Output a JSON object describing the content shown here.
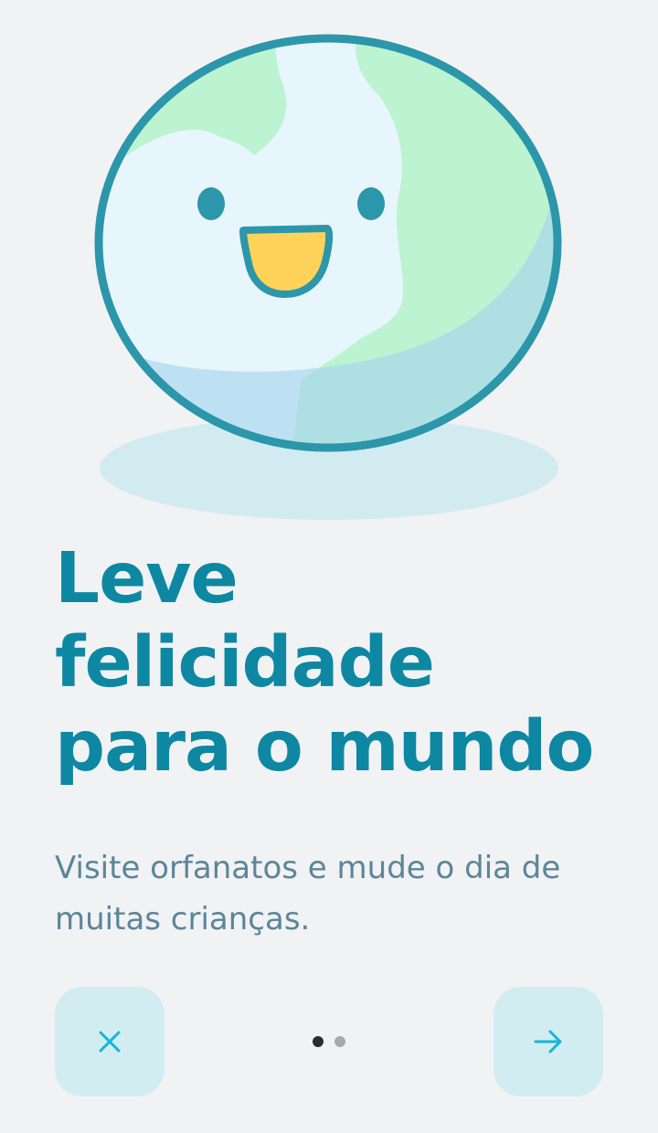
{
  "onboarding": {
    "title": "Leve felicidade para o mundo",
    "description": "Visite orfanatos e mude o dia de muitas crianças.",
    "illustration_icon": "smiling-earth-icon",
    "close_icon": "close-icon",
    "next_icon": "arrow-right-icon",
    "page_indicator": {
      "current_page": 1,
      "total_pages": 2
    }
  },
  "colors": {
    "background": "#F1F2F4",
    "title": "#0E88A2",
    "description": "#5C8599",
    "button_background": "#D1EDF2",
    "button_icon": "#15B6D6",
    "globe_outline": "#2C96AA",
    "globe_ocean": "#E7F6FC",
    "globe_land": "#BCF3D0",
    "globe_shadow": "#BBDFF1",
    "mouth": "#FFD35A",
    "dot_active": "#2C2C2C",
    "dot_inactive": "#A9A9AD"
  }
}
